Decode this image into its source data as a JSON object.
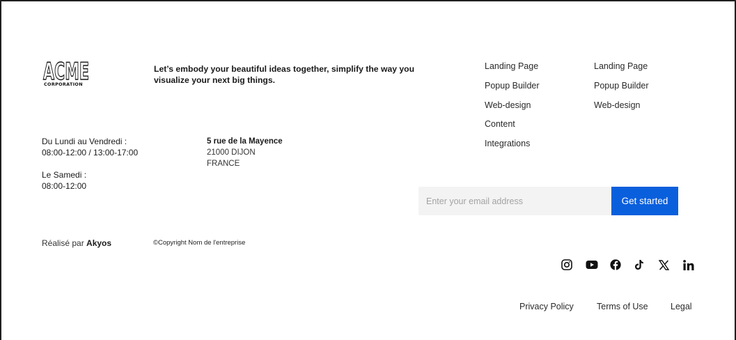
{
  "brand": {
    "logo_text": "ACME",
    "logo_subtext": "CORPORATION",
    "tagline": "Let’s embody your beautiful ideas together, simplify the way you visualize your next big things."
  },
  "hours": {
    "weekdays_label": "Du Lundi au Vendredi :",
    "weekdays_value": "08:00-12:00 / 13:00-17:00",
    "saturday_label": "Le Samedi :",
    "saturday_value": "08:00-12:00"
  },
  "address": {
    "street": "5 rue de la Mayence",
    "city": "21000 DIJON",
    "country": "FRANCE"
  },
  "links_col1": [
    "Landing Page",
    "Popup Builder",
    "Web-design",
    "Content",
    "Integrations"
  ],
  "links_col2": [
    "Landing Page",
    "Popup Builder",
    "Web-design"
  ],
  "newsletter": {
    "placeholder": "Enter your email address",
    "button_label": "Get started"
  },
  "credit": {
    "prefix": "Réalisé par",
    "agency": "Akyos"
  },
  "copyright": "©Copyright Nom de l'entreprise",
  "social_icons": [
    "instagram-icon",
    "youtube-icon",
    "facebook-icon",
    "tiktok-icon",
    "x-icon",
    "linkedin-icon"
  ],
  "legal": {
    "privacy": "Privacy Policy",
    "terms": "Terms of Use",
    "legal": "Legal"
  },
  "colors": {
    "accent": "#0a5fdc",
    "input_bg": "#f3f3f3",
    "text": "#1c1c1c"
  }
}
